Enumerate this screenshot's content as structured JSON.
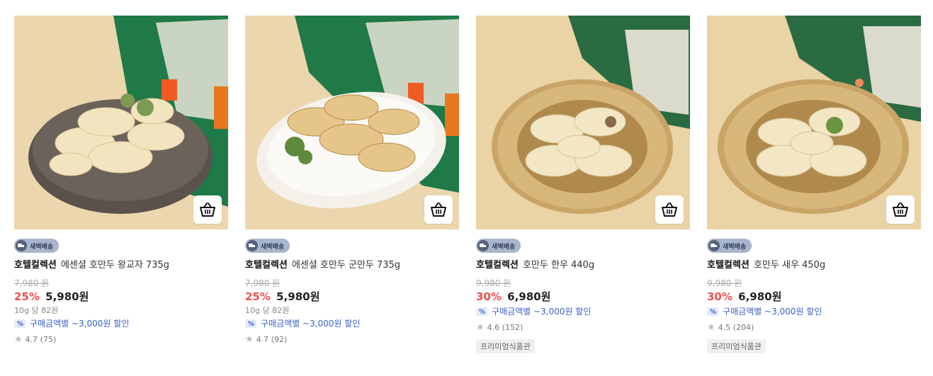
{
  "products": [
    {
      "delivery_badge": "새벽배송",
      "brand": "호텔컬렉션",
      "name": "에센셜 호만두 왕교자 735g",
      "original_price": "7,980 원",
      "discount_rate": "25%",
      "price": "5,980원",
      "unit_price": "10g 당 82원",
      "coupon": "구매금액별 ~3,000원 할인",
      "rating": "4.7",
      "reviews": "(75)",
      "tag": "",
      "image_style": "dark-plate"
    },
    {
      "delivery_badge": "새벽배송",
      "brand": "호텔컬렉션",
      "name": "에센셜 호만두 군만두 735g",
      "original_price": "7,980 원",
      "discount_rate": "25%",
      "price": "5,980원",
      "unit_price": "10g 당 82원",
      "coupon": "구매금액별 ~3,000원 할인",
      "rating": "4.7",
      "reviews": "(92)",
      "tag": "",
      "image_style": "white-plate"
    },
    {
      "delivery_badge": "새벽배송",
      "brand": "호텔컬렉션",
      "name": "호만두 한우 440g",
      "original_price": "9,980 원",
      "discount_rate": "30%",
      "price": "6,980원",
      "unit_price": "",
      "coupon": "구매금액별 ~3,000원 할인",
      "rating": "4.6",
      "reviews": "(152)",
      "tag": "프리미엄식품관",
      "image_style": "gold-plate"
    },
    {
      "delivery_badge": "새벽배송",
      "brand": "호텔컬렉션",
      "name": "호만두 새우 450g",
      "original_price": "9,980 원",
      "discount_rate": "30%",
      "price": "6,980원",
      "unit_price": "",
      "coupon": "구매금액별 ~3,000원 할인",
      "rating": "4.5",
      "reviews": "(204)",
      "tag": "프리미엄식품관",
      "image_style": "gold-plate"
    }
  ],
  "colors": {
    "discount": "#f04e4e",
    "coupon": "#3a5fc8",
    "package_green": "#1f7a47",
    "background": "#e9d3a8"
  },
  "icons": {
    "cart": "basket-icon",
    "delivery": "truck-icon",
    "coupon": "percent-icon",
    "rating": "star-icon"
  }
}
